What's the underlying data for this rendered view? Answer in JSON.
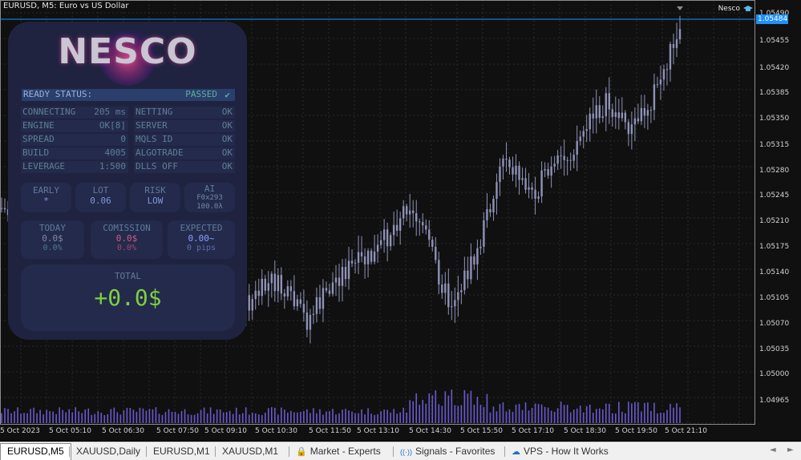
{
  "chart": {
    "title": "EURUSD, M5:  Euro vs US Dollar",
    "ea_name": "Nesco",
    "current_price": "1.05484",
    "price_levels": [
      "1.05490",
      "1.05455",
      "1.05420",
      "1.05385",
      "1.05350",
      "1.05315",
      "1.05280",
      "1.05245",
      "1.05210",
      "1.05175",
      "1.05140",
      "1.05105",
      "1.05070",
      "1.05035",
      "1.05000",
      "1.04965"
    ],
    "time_labels": [
      "5 Oct 2023",
      "5 Oct 05:10",
      "5 Oct 06:30",
      "5 Oct 07:50",
      "5 Oct 09:10",
      "5 Oct 10:30",
      "5 Oct 11:50",
      "5 Oct 13:10",
      "5 Oct 14:30",
      "5 Oct 15:50",
      "5 Oct 17:10",
      "5 Oct 18:30",
      "5 Oct 19:50",
      "5 Oct 21:10"
    ],
    "colors": {
      "candle": "#8f93b8",
      "volume": "#6a5acd",
      "grid": "#2a2a2a",
      "price_line": "#1e90ff"
    }
  },
  "panel": {
    "logo": "NESCO",
    "ready_label": "READY STATUS:",
    "ready_value": "PASSED",
    "ready_icon": "check-icon",
    "left_stats": [
      {
        "k": "CONNECTING",
        "v": "205 ms"
      },
      {
        "k": "ENGINE",
        "v": "OK[8]"
      },
      {
        "k": "SPREAD",
        "v": "0"
      },
      {
        "k": "BUILD",
        "v": "4005"
      },
      {
        "k": "LEVERAGE",
        "v": "1:500"
      }
    ],
    "right_stats": [
      {
        "k": "NETTING",
        "v": "OK"
      },
      {
        "k": "SERVER",
        "v": "OK"
      },
      {
        "k": "MQLS ID",
        "v": "OK"
      },
      {
        "k": "ALGOTRADE",
        "v": "OK"
      },
      {
        "k": "DLLS OFF",
        "v": "OK"
      }
    ],
    "boxes": [
      {
        "label": "EARLY",
        "value": "*"
      },
      {
        "label": "LOT",
        "value": "0.06"
      },
      {
        "label": "RISK",
        "value": "LOW"
      },
      {
        "label": "AI",
        "value": "F0x293",
        "value2": "100.0λ"
      }
    ],
    "today": {
      "label": "TODAY",
      "value": "0.0$",
      "sub": "0.0%"
    },
    "comission": {
      "label": "COMISSION",
      "value": "0.0$",
      "sub": "0.0%"
    },
    "expected": {
      "label": "EXPECTED",
      "value": "0.00~",
      "sub": "0 pips"
    },
    "total": {
      "label": "TOTAL",
      "value": "+0.0$"
    }
  },
  "tabs": [
    {
      "label": "EURUSD,M5",
      "active": true
    },
    {
      "label": "XAUUSD,Daily"
    },
    {
      "label": "EURUSD,M1"
    },
    {
      "label": "XAUUSD,M1"
    },
    {
      "label": "Market - Experts",
      "icon": "lock-icon"
    },
    {
      "label": "Signals - Favorites",
      "icon": "signal-icon"
    },
    {
      "label": "VPS - How It Works",
      "icon": "cloud-icon"
    }
  ],
  "nav": {
    "left": "◄",
    "right": "►"
  }
}
